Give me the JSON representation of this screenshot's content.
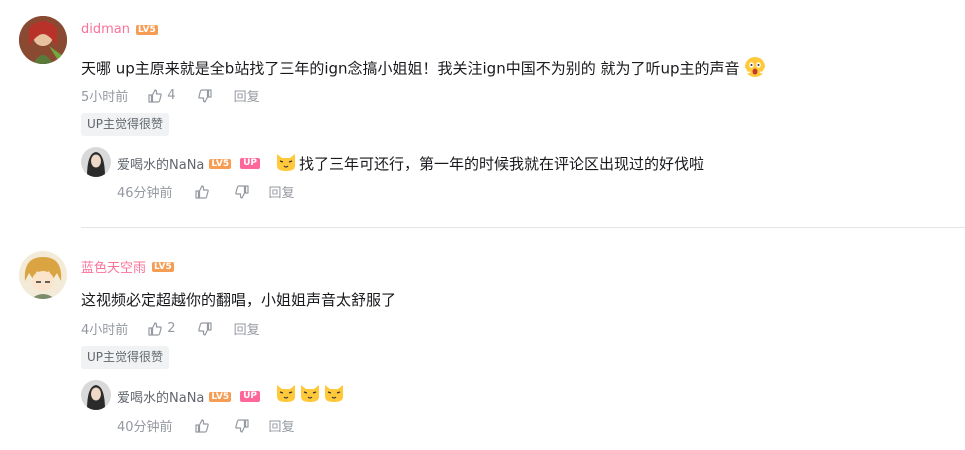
{
  "comments": [
    {
      "username": "didman",
      "level": "LV5",
      "content": "天哪 up主原来就是全b站找了三年的ign念搞小姐姐！我关注ign中国不为别的 就为了听up主的声音",
      "time": "5小时前",
      "likes": "4",
      "reply_label": "回复",
      "tag": "UP主觉得很赞",
      "reply": {
        "username": "爱喝水的NaNa",
        "level": "LV5",
        "up_badge": "UP",
        "content": "找了三年可还行，第一年的时候我就在评论区出现过的好伐啦",
        "time": "46分钟前",
        "reply_label": "回复"
      }
    },
    {
      "username": "蓝色天空雨",
      "level": "LV5",
      "content": "这视频必定超越你的翻唱，小姐姐声音太舒服了",
      "time": "4小时前",
      "likes": "2",
      "reply_label": "回复",
      "tag": "UP主觉得很赞",
      "reply": {
        "username": "爱喝水的NaNa",
        "level": "LV5",
        "up_badge": "UP",
        "content": "",
        "time": "40分钟前",
        "reply_label": "回复"
      }
    }
  ],
  "colors": {
    "username": "#fb7299",
    "level_badge": "#f69c53",
    "up_badge": "#ff6699",
    "meta": "#9499a0"
  }
}
